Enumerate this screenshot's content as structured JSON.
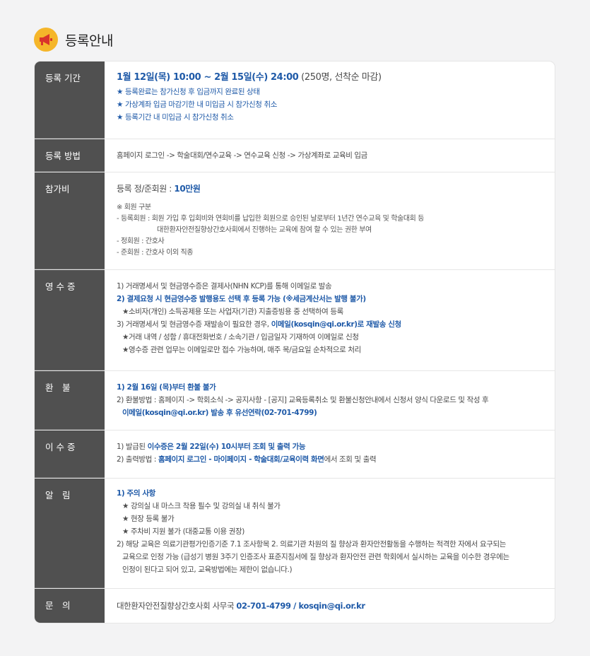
{
  "header": {
    "title": "등록안내",
    "icon": "megaphone-icon",
    "icon_color": "#f5b62a"
  },
  "rows": {
    "period": {
      "label": "등록 기간",
      "main_blue": "1월 12일(목) 10:00 ~ 2월 15일(수) 24:00",
      "main_rest": " (250명, 선착순 마감)",
      "notes": [
        "★ 등록완료는 참가신청 후 입금까지 완료된 상태",
        "★ 가상계좌 입금 마감기한 내 미입금 시 참가신청 취소",
        "★ 등록기간 내 미입금 시 참가신청 취소"
      ]
    },
    "method": {
      "label": "등록 방법",
      "text": "홈페이지 로그인 -> 학술대회/연수교육 -> 연수교육 신청 -> 가상계좌로 교육비 입금"
    },
    "fee": {
      "label": "참가비",
      "main_prefix": "등록 정/준회원 : ",
      "main_blue": "10만원",
      "lines": [
        "※ 회원 구분",
        "- 등록회원 : 회원 가입 후 입회비와 연회비를 납입한 회원으로 승인된 날로부터 1년간 연수교육 및 학술대회 등",
        "대한환자안전질향상간호사회에서 진행하는 교육에 참여 할 수 있는 권한 부여",
        "- 정회원 : 간호사",
        "- 준회원 : 간호사 이외 직종"
      ]
    },
    "receipt": {
      "label": "영 수 증",
      "l1": "1) 거래명세서 및 현금영수증은 결제사(NHN KCP)를 통해 이메일로 발송",
      "l2": "2) 결제요청 시 현금영수증 발행용도 선택 후 등록 가능 (※세금계산서는 발행 불가)",
      "l3": "★소비자(개인) 소득공제용 또는 사업자(기관) 지출증빙용 중 선택하여 등록",
      "l4_prefix": "3) 거래명세서 및 현금영수증 재발송이 필요한 경우, ",
      "l4_blue": "이메일(kosqin@qi.or.kr)로 재발송 신청",
      "l5": "★거래 내역 / 성함 / 휴대전화번호 / 소속기관 / 입금일자 기재하여 이메일로 신청",
      "l6": "★영수증 관련 업무는 이메일로만 접수 가능하며, 매주 목/금요일 순차적으로 처리"
    },
    "refund": {
      "label": "환　불",
      "l1": "1) 2월 16일 (목)부터 환불 불가",
      "l2": "2) 환불방법 : 홈페이지 -> 학회소식 -> 공지사항 - [공지] 교육등록취소 및 환불신청안내에서 신청서 양식 다운로드 및 작성 후",
      "l3": "이메일(kosqin@qi.or.kr) 발송 후 유선연락(02-701-4799)"
    },
    "cert": {
      "label": "이 수 증",
      "l1_prefix": "1) 발급된 ",
      "l1_blue": "이수증은 2월 22일(수) 10시부터 조회 및 출력 가능",
      "l2_prefix": "2) 출력방법 : ",
      "l2_blue": "홈페이지 로그인 - 마이페이지 - 학술대회/교육이력 화면",
      "l2_suffix": "에서 조회 및 출력"
    },
    "notice": {
      "label": "알　림",
      "l1": "1) 주의 사항",
      "items": [
        "★ 강의실 내 마스크 착용 필수 및 강의실 내 취식 불가",
        "★ 현장 등록 불가",
        "★ 주차비 지원 불가 (대중교통 이용 권장)"
      ],
      "l2": [
        "2) 해당 교육은 의료기관평가인증기준 7.1 조사항목 2. 의료기관 차원의 질 향상과 환자안전활동을 수행하는 적격한 자에서 요구되는",
        "교육으로 인정 가능 (급성기 병원 3주기 인증조사 표준지침서에 질 향상과 환자안전 관련 학회에서 실시하는 교육을 이수한 경우에는",
        "인정이 된다고 되어 있고, 교육방법에는 제한이 없습니다.)"
      ]
    },
    "contact": {
      "label": "문　의",
      "prefix": "대한환자안전질향상간호사회 사무국 ",
      "blue": "02-701-4799 / kosqin@qi.or.kr"
    }
  }
}
